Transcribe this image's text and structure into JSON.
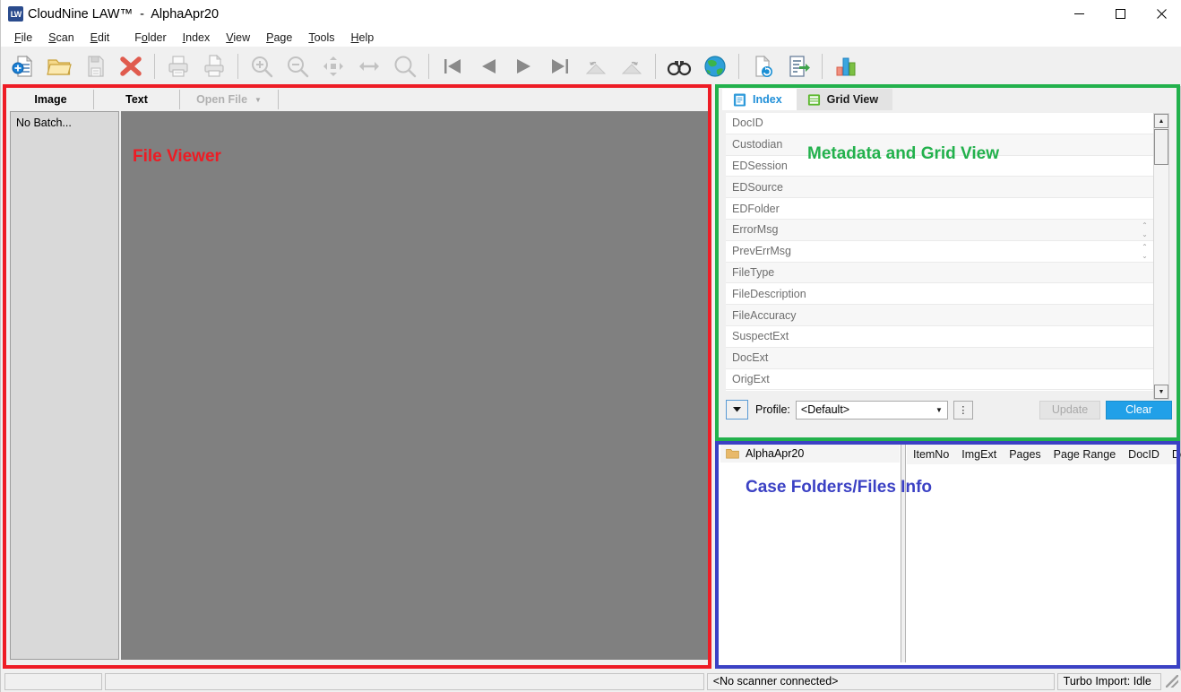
{
  "window": {
    "app_name": "CloudNine LAW™",
    "separator": "  -  ",
    "document": "AlphaApr20",
    "title_full": "CloudNine LAW™  -  AlphaApr20",
    "icon_name": "cloudnine-law-logo",
    "logo_text": "LW",
    "controls": {
      "minimize": "Minimize",
      "maximize": "Maximize",
      "close": "Close"
    }
  },
  "menu": {
    "items": [
      {
        "label": "File",
        "accel": "F"
      },
      {
        "label": "Scan",
        "accel": "S"
      },
      {
        "label": "Edit",
        "accel": "E"
      },
      {
        "label": "Folder",
        "accel": "o"
      },
      {
        "label": "Index",
        "accel": "I"
      },
      {
        "label": "View",
        "accel": "V"
      },
      {
        "label": "Page",
        "accel": "P"
      },
      {
        "label": "Tools",
        "accel": "T"
      },
      {
        "label": "Help",
        "accel": "H"
      }
    ]
  },
  "toolbar": {
    "buttons": [
      {
        "name": "new-document-icon",
        "title": "New Document",
        "enabled": true
      },
      {
        "name": "open-folder-icon",
        "title": "Open Folder",
        "enabled": true
      },
      {
        "name": "save-document-icon",
        "title": "Save",
        "enabled": false
      },
      {
        "name": "delete-icon",
        "title": "Delete",
        "enabled": true
      },
      {
        "name": "print-icon",
        "title": "Print",
        "enabled": false
      },
      {
        "name": "print-preview-icon",
        "title": "Print Preview",
        "enabled": false
      },
      {
        "name": "zoom-in-icon",
        "title": "Zoom In",
        "enabled": false
      },
      {
        "name": "zoom-out-icon",
        "title": "Zoom Out",
        "enabled": false
      },
      {
        "name": "fit-page-icon",
        "title": "Fit Page",
        "enabled": false
      },
      {
        "name": "fit-width-icon",
        "title": "Fit Width",
        "enabled": false
      },
      {
        "name": "magnifier-icon",
        "title": "Zoom",
        "enabled": false
      },
      {
        "name": "first-page-icon",
        "title": "First Page",
        "enabled": true
      },
      {
        "name": "previous-page-icon",
        "title": "Previous Page",
        "enabled": true
      },
      {
        "name": "next-page-icon",
        "title": "Next Page",
        "enabled": true
      },
      {
        "name": "last-page-icon",
        "title": "Last Page",
        "enabled": true
      },
      {
        "name": "rotate-left-icon",
        "title": "Rotate Left",
        "enabled": false
      },
      {
        "name": "rotate-right-icon",
        "title": "Rotate Right",
        "enabled": false
      },
      {
        "name": "binoculars-icon",
        "title": "Search",
        "enabled": true
      },
      {
        "name": "globe-icon",
        "title": "Web",
        "enabled": true
      },
      {
        "name": "refresh-document-icon",
        "title": "Refresh",
        "enabled": true
      },
      {
        "name": "export-document-icon",
        "title": "Export",
        "enabled": true
      },
      {
        "name": "bar-chart-icon",
        "title": "Reports",
        "enabled": true
      }
    ]
  },
  "viewer": {
    "tabs": [
      {
        "label": "Image",
        "active": true,
        "enabled": true
      },
      {
        "label": "Text",
        "active": false,
        "enabled": true
      },
      {
        "label": "Open File",
        "active": false,
        "enabled": false,
        "has_caret": true
      }
    ],
    "batch_tree": {
      "label": "No Batch..."
    },
    "canvas_color": "#808080"
  },
  "index_panel": {
    "tabs": [
      {
        "label": "Index",
        "icon": "index-document-icon",
        "active": true
      },
      {
        "label": "Grid View",
        "icon": "grid-view-icon",
        "active": false
      }
    ],
    "fields": [
      {
        "label": "DocID",
        "value": "",
        "spinner": false
      },
      {
        "label": "Custodian",
        "value": "",
        "spinner": false
      },
      {
        "label": "EDSession",
        "value": "",
        "spinner": false
      },
      {
        "label": "EDSource",
        "value": "",
        "spinner": false
      },
      {
        "label": "EDFolder",
        "value": "",
        "spinner": false
      },
      {
        "label": "ErrorMsg",
        "value": "",
        "spinner": true
      },
      {
        "label": "PrevErrMsg",
        "value": "",
        "spinner": true
      },
      {
        "label": "FileType",
        "value": "",
        "spinner": false
      },
      {
        "label": "FileDescription",
        "value": "",
        "spinner": false
      },
      {
        "label": "FileAccuracy",
        "value": "",
        "spinner": false
      },
      {
        "label": "SuspectExt",
        "value": "",
        "spinner": false
      },
      {
        "label": "DocExt",
        "value": "",
        "spinner": false
      },
      {
        "label": "OrigExt",
        "value": "",
        "spinner": false
      }
    ],
    "profile_bar": {
      "toggle_icon": "chevron-down-icon",
      "label": "Profile:",
      "selected": "<Default>",
      "options_icon": "kebab-menu-icon",
      "options_glyph": "⋮",
      "update_label": "Update",
      "update_enabled": false,
      "clear_label": "Clear",
      "clear_enabled": true,
      "clear_color": "#21a0e8"
    }
  },
  "case_panel": {
    "folder_tree": {
      "root_label": "AlphaApr20",
      "icon": "folder-icon"
    },
    "grid": {
      "columns": [
        "ItemNo",
        "ImgExt",
        "Pages",
        "Page Range",
        "DocID",
        "DocExt"
      ],
      "rows": []
    }
  },
  "statusbar": {
    "cell_left": "",
    "cell_mid": "",
    "scanner": "<No scanner connected>",
    "turbo_import": "Turbo Import: Idle",
    "grip_icon": "resize-grip-icon"
  },
  "annotations": [
    {
      "name": "file-viewer-annotation",
      "text": "File Viewer",
      "color": "#ed1c24"
    },
    {
      "name": "metadata-grid-annotation",
      "text": "Metadata and Grid View",
      "color": "#22b14c"
    },
    {
      "name": "case-folders-annotation",
      "text": "Case Folders/Files Info",
      "color": "#3b41c4"
    }
  ]
}
